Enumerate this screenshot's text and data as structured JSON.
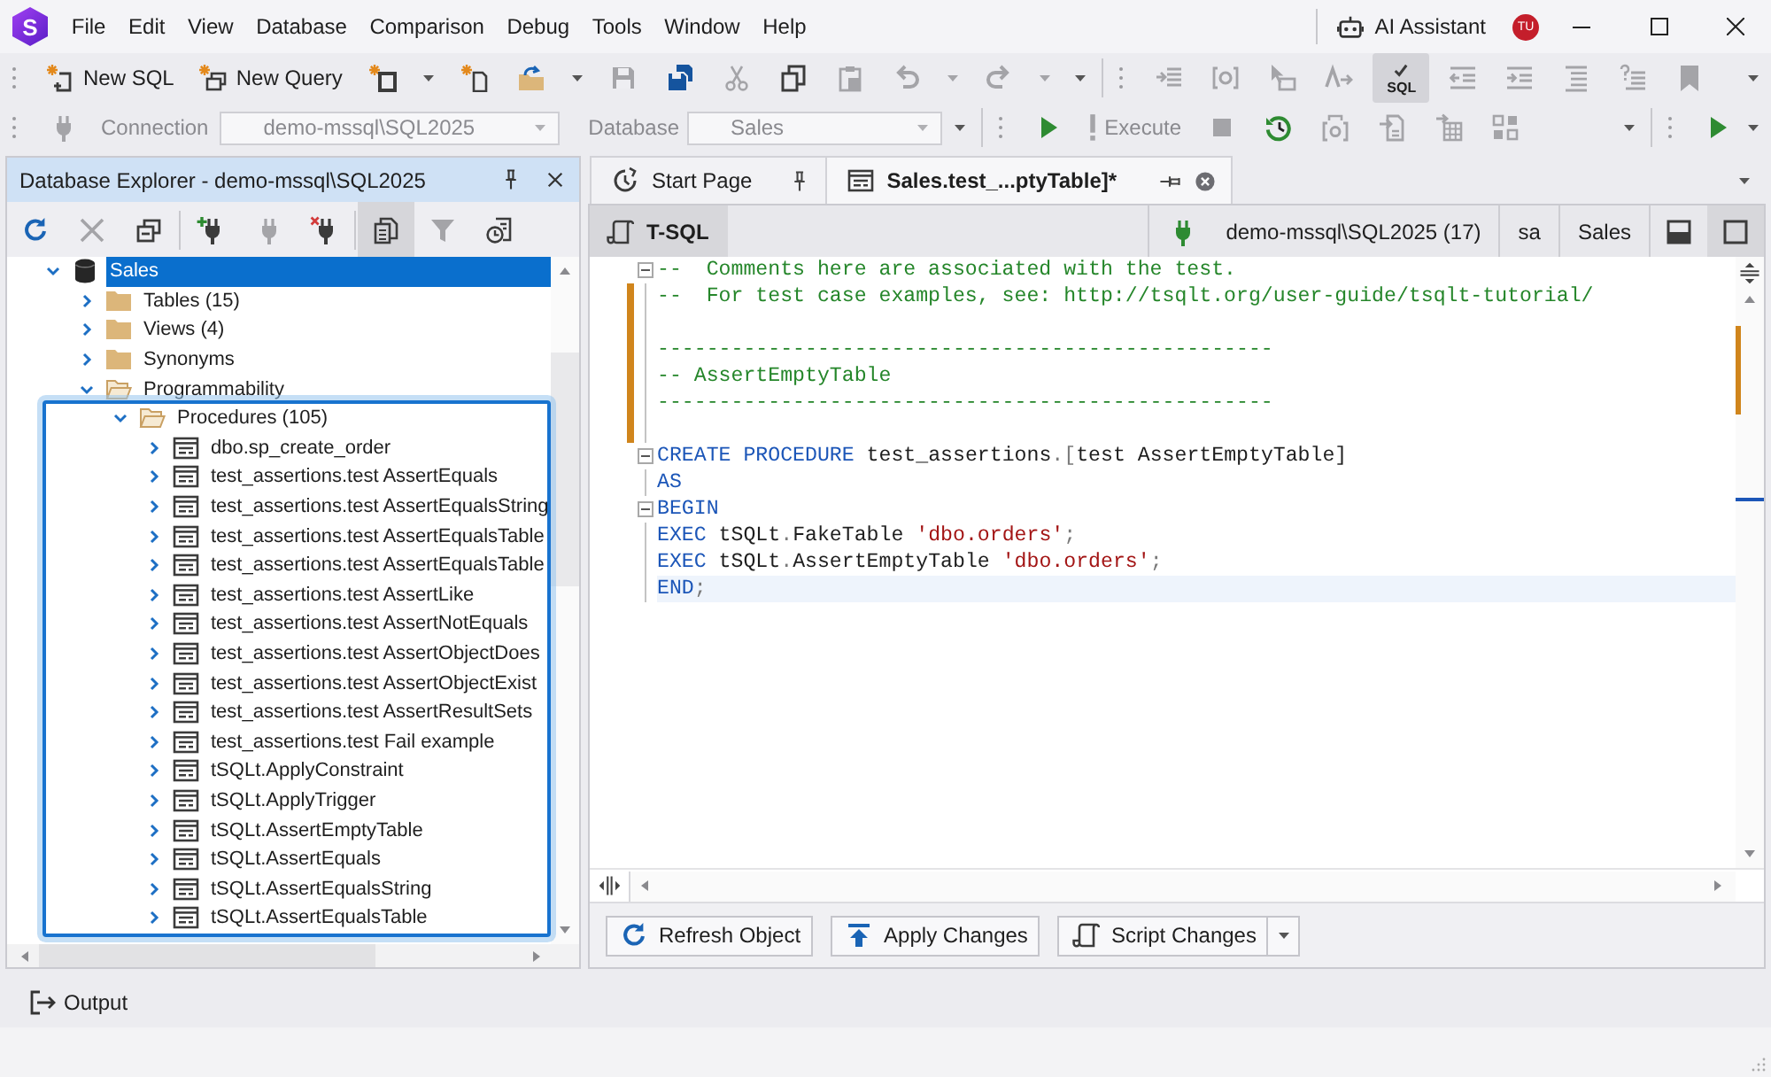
{
  "titlebar": {
    "logo": "S",
    "menu": [
      "File",
      "Edit",
      "View",
      "Database",
      "Comparison",
      "Debug",
      "Tools",
      "Window",
      "Help"
    ],
    "assistant": "AI Assistant",
    "avatar": "TU"
  },
  "toolbar_main": [
    {
      "items": [
        {
          "kind": "new-sql",
          "label": "New SQL",
          "disabled": false,
          "on": false
        },
        {
          "kind": "new-query",
          "label": "New Query",
          "disabled": false,
          "on": false
        },
        {
          "kind": "new-object",
          "disabled": false,
          "on": false
        },
        {
          "kind": "dropdown",
          "disabled": false,
          "on": false
        },
        {
          "kind": "new-file",
          "disabled": false,
          "on": false
        },
        {
          "kind": "open",
          "disabled": false,
          "on": false
        },
        {
          "kind": "dropdown",
          "disabled": false,
          "on": false
        },
        {
          "kind": "save",
          "disabled": true,
          "on": false
        },
        {
          "kind": "save-all",
          "disabled": false,
          "on": false
        },
        {
          "kind": "cut",
          "disabled": true,
          "on": false
        },
        {
          "kind": "copy",
          "disabled": false,
          "on": false
        },
        {
          "kind": "paste",
          "disabled": true,
          "on": false
        },
        {
          "kind": "undo",
          "disabled": true,
          "on": false
        },
        {
          "kind": "dropdown",
          "disabled": true,
          "on": false
        },
        {
          "kind": "redo",
          "disabled": true,
          "on": false
        },
        {
          "kind": "dropdown",
          "disabled": true,
          "on": false
        }
      ]
    },
    {
      "items": [
        {
          "kind": "comment",
          "disabled": true,
          "on": false
        },
        {
          "kind": "parameter",
          "disabled": true,
          "on": false
        },
        {
          "kind": "select",
          "disabled": true,
          "on": false
        },
        {
          "kind": "rename",
          "disabled": true,
          "on": false
        },
        {
          "kind": "sql-check",
          "label": "SQL",
          "disabled": false,
          "on": true
        },
        {
          "kind": "outdent",
          "disabled": true,
          "on": false
        },
        {
          "kind": "indent",
          "disabled": true,
          "on": false
        },
        {
          "kind": "format",
          "disabled": true,
          "on": false
        },
        {
          "kind": "hint",
          "disabled": true,
          "on": false
        },
        {
          "kind": "bookmark",
          "disabled": true,
          "on": false
        }
      ]
    }
  ],
  "toolbar_connection": {
    "connect": {
      "kind": "connect",
      "disabled": true,
      "on": false
    },
    "connection": {
      "label": "Connection",
      "value": "demo-mssql\\SQL2025",
      "disabled": true
    },
    "database": {
      "label": "Database",
      "value": "Sales",
      "disabled": true
    },
    "segments": [
      {
        "items": [
          {
            "kind": "run",
            "disabled": false,
            "on": false
          },
          {
            "kind": "execute",
            "label": "Execute",
            "disabled": true,
            "on": false
          },
          {
            "kind": "stop",
            "disabled": true,
            "on": false
          },
          {
            "kind": "history",
            "disabled": false,
            "on": false
          },
          {
            "kind": "params",
            "disabled": true,
            "on": false
          },
          {
            "kind": "export",
            "disabled": true,
            "on": false
          },
          {
            "kind": "import",
            "disabled": true,
            "on": false
          },
          {
            "kind": "layout",
            "disabled": true,
            "on": false
          }
        ]
      },
      {
        "items": [
          {
            "kind": "debug",
            "disabled": false,
            "on": false
          }
        ]
      }
    ]
  },
  "explorer": {
    "title": "Database Explorer - demo-mssql\\SQL2025",
    "toolbar": [
      [
        {
          "kind": "refresh",
          "disabled": false,
          "on": false
        },
        {
          "kind": "delete",
          "disabled": true,
          "on": false
        },
        {
          "kind": "collapse",
          "disabled": false,
          "on": false
        }
      ],
      [
        {
          "kind": "new-connection",
          "disabled": false,
          "on": false
        },
        {
          "kind": "connect",
          "disabled": true,
          "on": false
        },
        {
          "kind": "disconnect",
          "disabled": false,
          "on": false
        }
      ],
      [
        {
          "kind": "duplicate",
          "disabled": false,
          "on": true
        },
        {
          "kind": "filter",
          "disabled": true,
          "on": false
        },
        {
          "kind": "schedule",
          "disabled": false,
          "on": false
        }
      ]
    ],
    "tree": [
      {
        "label": "Sales",
        "kind": "database",
        "expanded": true,
        "selected": true,
        "highlighted": false,
        "children": [
          {
            "label": "Tables (15)",
            "kind": "folder",
            "expanded": false,
            "selected": false,
            "highlighted": false
          },
          {
            "label": "Views (4)",
            "kind": "folder",
            "expanded": false,
            "selected": false,
            "highlighted": false
          },
          {
            "label": "Synonyms",
            "kind": "folder",
            "expanded": false,
            "selected": false,
            "highlighted": false
          },
          {
            "label": "Programmability",
            "kind": "folder",
            "expanded": true,
            "selected": false,
            "highlighted": false,
            "children": [
              {
                "label": "Procedures (105)",
                "kind": "folder",
                "expanded": true,
                "selected": false,
                "highlighted": true,
                "children": [
                  {
                    "label": "dbo.sp_create_order",
                    "kind": "procedure",
                    "expanded": false,
                    "selected": false,
                    "highlighted": false
                  },
                  {
                    "label": "test_assertions.test AssertEquals",
                    "kind": "procedure",
                    "expanded": false,
                    "selected": false,
                    "highlighted": false
                  },
                  {
                    "label": "test_assertions.test AssertEqualsString",
                    "kind": "procedure",
                    "expanded": false,
                    "selected": false,
                    "highlighted": false
                  },
                  {
                    "label": "test_assertions.test AssertEqualsTable",
                    "kind": "procedure",
                    "expanded": false,
                    "selected": false,
                    "highlighted": false
                  },
                  {
                    "label": "test_assertions.test AssertEqualsTable",
                    "kind": "procedure",
                    "expanded": false,
                    "selected": false,
                    "highlighted": false
                  },
                  {
                    "label": "test_assertions.test AssertLike",
                    "kind": "procedure",
                    "expanded": false,
                    "selected": false,
                    "highlighted": false
                  },
                  {
                    "label": "test_assertions.test AssertNotEquals",
                    "kind": "procedure",
                    "expanded": false,
                    "selected": false,
                    "highlighted": false
                  },
                  {
                    "label": "test_assertions.test AssertObjectDoes",
                    "kind": "procedure",
                    "expanded": false,
                    "selected": false,
                    "highlighted": false
                  },
                  {
                    "label": "test_assertions.test AssertObjectExist",
                    "kind": "procedure",
                    "expanded": false,
                    "selected": false,
                    "highlighted": false
                  },
                  {
                    "label": "test_assertions.test AssertResultSets",
                    "kind": "procedure",
                    "expanded": false,
                    "selected": false,
                    "highlighted": false
                  },
                  {
                    "label": "test_assertions.test Fail example",
                    "kind": "procedure",
                    "expanded": false,
                    "selected": false,
                    "highlighted": false
                  },
                  {
                    "label": "tSQLt.ApplyConstraint",
                    "kind": "procedure",
                    "expanded": false,
                    "selected": false,
                    "highlighted": false
                  },
                  {
                    "label": "tSQLt.ApplyTrigger",
                    "kind": "procedure",
                    "expanded": false,
                    "selected": false,
                    "highlighted": false
                  },
                  {
                    "label": "tSQLt.AssertEmptyTable",
                    "kind": "procedure",
                    "expanded": false,
                    "selected": false,
                    "highlighted": false
                  },
                  {
                    "label": "tSQLt.AssertEquals",
                    "kind": "procedure",
                    "expanded": false,
                    "selected": false,
                    "highlighted": false
                  },
                  {
                    "label": "tSQLt.AssertEqualsString",
                    "kind": "procedure",
                    "expanded": false,
                    "selected": false,
                    "highlighted": false
                  },
                  {
                    "label": "tSQLt.AssertEqualsTable",
                    "kind": "procedure",
                    "expanded": false,
                    "selected": false,
                    "highlighted": false
                  }
                ]
              }
            ]
          }
        ]
      }
    ]
  },
  "tabs": [
    {
      "label": "Start Page",
      "kind": "start",
      "selected": false,
      "pinned": true
    },
    {
      "label": "Sales.test_...ptyTable]*",
      "kind": "document",
      "selected": true,
      "pinned": false
    }
  ],
  "editor_toolbar": {
    "mode": {
      "label": "T-SQL",
      "on": true
    },
    "connected": true,
    "connection": "demo-mssql\\SQL2025 (17)",
    "user": "sa",
    "database": "Sales",
    "views": [
      {
        "kind": "split",
        "selected": false
      },
      {
        "kind": "single",
        "selected": true
      }
    ]
  },
  "editor": {
    "lines": [
      {
        "tokens": [
          {
            "kind": "comment",
            "text": "--  Comments here are associated with the test."
          }
        ],
        "fold": true
      },
      {
        "tokens": [
          {
            "kind": "comment",
            "text": "--  For test case examples, see: http://tsqlt.org/user-guide/tsqlt-tutorial/"
          }
        ],
        "fold": false,
        "changed": true
      },
      {
        "fold": false,
        "changed": true
      },
      {
        "tokens": [
          {
            "kind": "comment",
            "text": "--------------------------------------------------"
          }
        ],
        "fold": false,
        "changed": true
      },
      {
        "tokens": [
          {
            "kind": "comment",
            "text": "-- AssertEmptyTable"
          }
        ],
        "fold": false,
        "changed": true
      },
      {
        "tokens": [
          {
            "kind": "comment",
            "text": "--------------------------------------------------"
          }
        ],
        "fold": false,
        "changed": true
      },
      {
        "fold": false,
        "changed": true
      },
      {
        "tokens": [
          {
            "kind": "keyword",
            "text": "CREATE PROCEDURE"
          },
          {
            "kind": "name",
            "text": " test_assertions"
          },
          {
            "kind": "punct",
            "text": ".["
          },
          {
            "kind": "name",
            "text": "test AssertEmptyTable]"
          }
        ],
        "fold": true
      },
      {
        "tokens": [
          {
            "kind": "keyword",
            "text": "AS"
          }
        ],
        "fold": false
      },
      {
        "tokens": [
          {
            "kind": "keyword",
            "text": "BEGIN"
          }
        ],
        "fold": true
      },
      {
        "tokens": [
          {
            "kind": "keyword",
            "text": "EXEC"
          },
          {
            "kind": "name",
            "text": " tSQLt"
          },
          {
            "kind": "punct",
            "text": "."
          },
          {
            "kind": "name",
            "text": "FakeTable "
          },
          {
            "kind": "string",
            "text": "'dbo.orders'"
          },
          {
            "kind": "punct",
            "text": ";"
          }
        ],
        "fold": false
      },
      {
        "tokens": [
          {
            "kind": "keyword",
            "text": "EXEC"
          },
          {
            "kind": "name",
            "text": " tSQLt"
          },
          {
            "kind": "punct",
            "text": "."
          },
          {
            "kind": "name",
            "text": "AssertEmptyTable "
          },
          {
            "kind": "string",
            "text": "'dbo.orders'"
          },
          {
            "kind": "punct",
            "text": ";"
          }
        ],
        "fold": false
      },
      {
        "tokens": [
          {
            "kind": "keyword",
            "text": "END"
          },
          {
            "kind": "punct",
            "text": ";"
          }
        ],
        "fold": false,
        "current": true
      }
    ]
  },
  "actions": [
    {
      "kind": "refresh",
      "label": "Refresh Object"
    },
    {
      "kind": "apply",
      "label": "Apply Changes"
    },
    {
      "kind": "script",
      "label": "Script Changes"
    },
    {
      "kind": "dropdown"
    }
  ],
  "output_tab": "Output"
}
